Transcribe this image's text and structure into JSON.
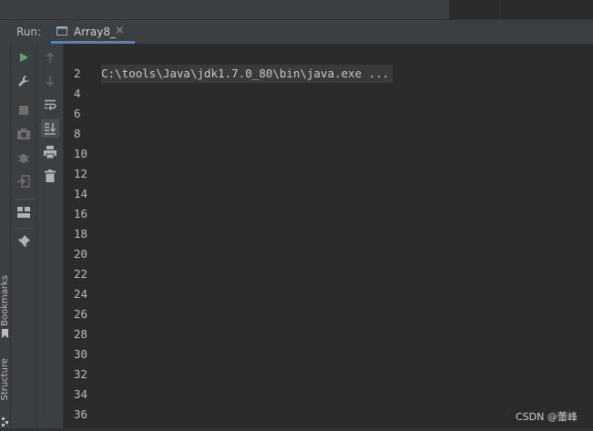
{
  "run_bar": {
    "label": "Run:",
    "tab": {
      "label": "Array8_",
      "close": "×"
    }
  },
  "left_sidebar": {
    "bookmarks": "Bookmarks",
    "structure": "Structure"
  },
  "toolbar_icons": [
    "run-icon",
    "wrench-icon",
    "stop-icon",
    "camera-icon",
    "debug-bug-icon",
    "exit-icon",
    "layout-icon",
    "pin-icon",
    "arrow-up-icon",
    "arrow-down-icon",
    "soft-wrap-icon",
    "scroll-to-end-icon",
    "print-icon",
    "trash-icon"
  ],
  "console": {
    "command": "C:\\tools\\Java\\jdk1.7.0_80\\bin\\java.exe ...",
    "lines": [
      "2",
      "4",
      "6",
      "8",
      "10",
      "12",
      "14",
      "16",
      "18",
      "20",
      "22",
      "24",
      "26",
      "28",
      "30",
      "32",
      "34",
      "36"
    ]
  },
  "watermark": "CSDN @蕾峰",
  "colors": {
    "background": "#2b2b2b",
    "panel": "#3c3f41",
    "tab_underline": "#4a88c7",
    "run_green": "#59a869"
  }
}
